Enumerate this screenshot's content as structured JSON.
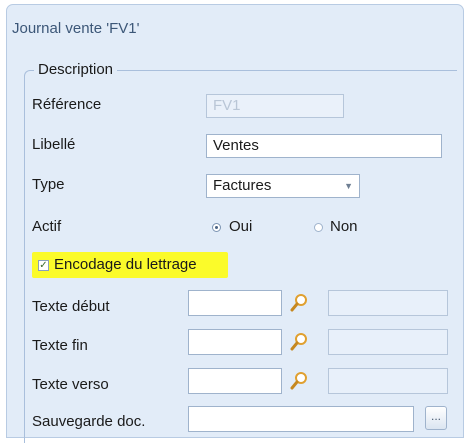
{
  "window": {
    "title": "Journal vente 'FV1'"
  },
  "group": {
    "legend": "Description"
  },
  "reference": {
    "label": "Référence",
    "value": "FV1"
  },
  "libelle": {
    "label": "Libellé",
    "value": "Ventes"
  },
  "type": {
    "label": "Type",
    "value": "Factures"
  },
  "actif": {
    "label": "Actif",
    "oui": "Oui",
    "non": "Non",
    "selected": "Oui"
  },
  "encodage": {
    "label": "Encodage du lettrage",
    "checked": true,
    "check_glyph": "✓",
    "highlight_color": "#fbfb2a"
  },
  "texte_debut": {
    "label": "Texte début",
    "value": ""
  },
  "texte_fin": {
    "label": "Texte fin",
    "value": ""
  },
  "texte_verso": {
    "label": "Texte verso",
    "value": ""
  },
  "sauvegarde": {
    "label": "Sauvegarde doc.",
    "value": "",
    "button_label": "..."
  },
  "icons": {
    "search": "search-icon",
    "dropdown": "chevron-down-icon"
  }
}
